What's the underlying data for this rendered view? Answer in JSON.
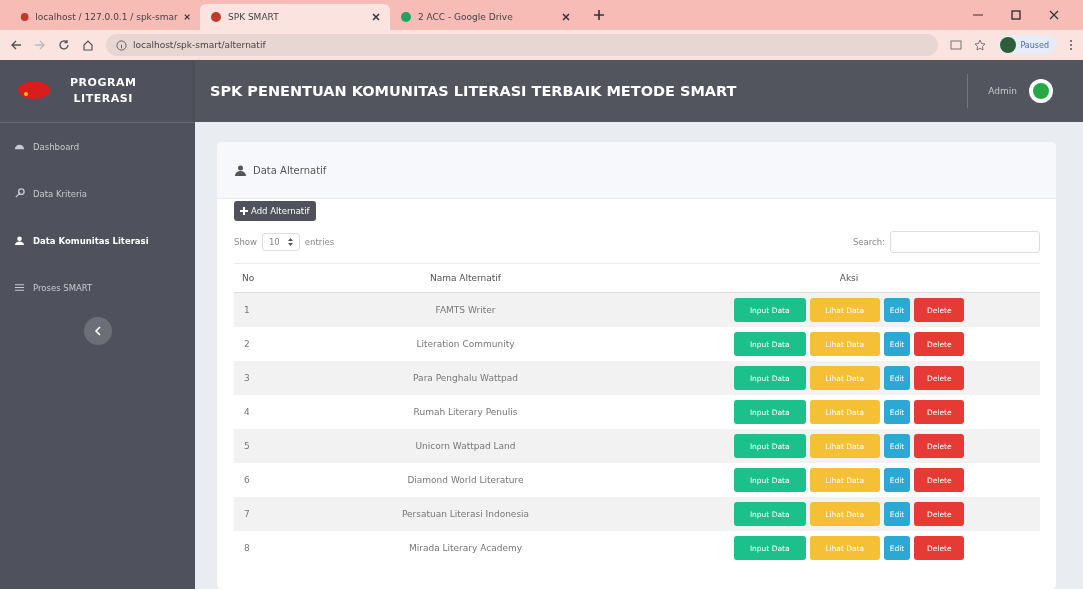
{
  "browser": {
    "tabs": [
      {
        "title": "localhost / 127.0.0.1 / spk-smar",
        "selected": false
      },
      {
        "title": "SPK SMART",
        "selected": true
      },
      {
        "title": "2 ACC - Google Drive",
        "selected": false
      }
    ],
    "address": "localhost/spk-smart/alternatif",
    "profile": "Paused"
  },
  "brand": {
    "line1": "PROGRAM",
    "line2": "LITERASI"
  },
  "header": {
    "title": "SPK PENENTUAN KOMUNITAS LITERASI TERBAIK METODE SMART",
    "user": "Admin"
  },
  "sidebar": {
    "items": [
      {
        "label": "Dashboard",
        "selected": false
      },
      {
        "label": "Data Kriteria",
        "selected": false
      },
      {
        "label": "Data Komunitas Literasi",
        "selected": true
      },
      {
        "label": "Proses SMART",
        "selected": false
      }
    ]
  },
  "card": {
    "title": "Data Alternatif",
    "add_button": "Add Alternatif"
  },
  "table_controls": {
    "show": "Show",
    "page_size": "10",
    "entries": "entries",
    "search": "Search:"
  },
  "table": {
    "columns": [
      "No",
      "Nama Alternatif",
      "Aksi"
    ],
    "rows": [
      {
        "no": "1",
        "name": "FAMTS Writer",
        "actions": [
          {
            "label": "Input Data",
            "kind": "success"
          },
          {
            "label": "Lihat Data",
            "kind": "warning"
          },
          {
            "label": "Edit",
            "kind": "info"
          },
          {
            "label": "Delete",
            "kind": "danger"
          }
        ]
      },
      {
        "no": "2",
        "name": "Literation Community",
        "actions": [
          {
            "label": "Input Data",
            "kind": "success"
          },
          {
            "label": "Lihat Data",
            "kind": "warning"
          },
          {
            "label": "Edit",
            "kind": "info"
          },
          {
            "label": "Delete",
            "kind": "danger"
          }
        ]
      },
      {
        "no": "3",
        "name": "Para Penghalu Wattpad",
        "actions": [
          {
            "label": "Input Data",
            "kind": "success"
          },
          {
            "label": "Lihat Data",
            "kind": "warning"
          },
          {
            "label": "Edit",
            "kind": "info"
          },
          {
            "label": "Delete",
            "kind": "danger"
          }
        ]
      },
      {
        "no": "4",
        "name": "Rumah Literary Penulis",
        "actions": [
          {
            "label": "Input Data",
            "kind": "success"
          },
          {
            "label": "Lihat Data",
            "kind": "warning"
          },
          {
            "label": "Edit",
            "kind": "info"
          },
          {
            "label": "Delete",
            "kind": "danger"
          }
        ]
      },
      {
        "no": "5",
        "name": "Unicorn Wattpad Land",
        "actions": [
          {
            "label": "Input Data",
            "kind": "success"
          },
          {
            "label": "Lihat Data",
            "kind": "warning"
          },
          {
            "label": "Edit",
            "kind": "info"
          },
          {
            "label": "Delete",
            "kind": "danger"
          }
        ]
      },
      {
        "no": "6",
        "name": "Diamond World Literature",
        "actions": [
          {
            "label": "Input Data",
            "kind": "success"
          },
          {
            "label": "Lihat Data",
            "kind": "warning"
          },
          {
            "label": "Edit",
            "kind": "info"
          },
          {
            "label": "Delete",
            "kind": "danger"
          }
        ]
      },
      {
        "no": "7",
        "name": "Persatuan Literasi Indonesia",
        "actions": [
          {
            "label": "Input Data",
            "kind": "success"
          },
          {
            "label": "Lihat Data",
            "kind": "warning"
          },
          {
            "label": "Edit",
            "kind": "info"
          },
          {
            "label": "Delete",
            "kind": "danger"
          }
        ]
      },
      {
        "no": "8",
        "name": "Mirada Literary Academy",
        "actions": [
          {
            "label": "Input Data",
            "kind": "success"
          },
          {
            "label": "Lihat Data",
            "kind": "warning"
          },
          {
            "label": "Edit",
            "kind": "info"
          },
          {
            "label": "Delete",
            "kind": "danger"
          }
        ]
      }
    ]
  }
}
